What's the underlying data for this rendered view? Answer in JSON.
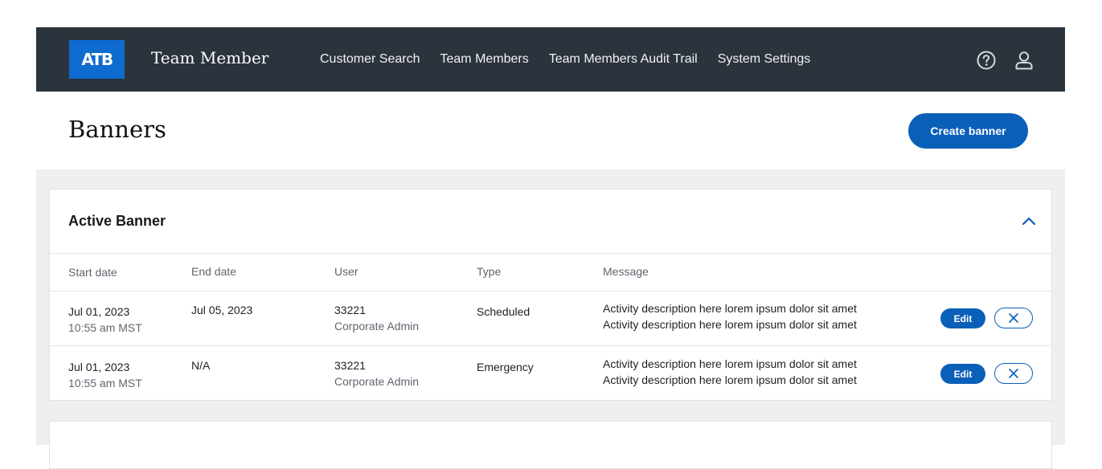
{
  "header": {
    "logo_text": "ATB",
    "app_title": "Team Member",
    "nav": [
      "Customer Search",
      "Team Members",
      "Team Members Audit Trail",
      "System Settings"
    ],
    "icons": [
      "help-circle-icon",
      "user-icon"
    ],
    "background_color": "#2b333c",
    "logo_color": "#0e6bd0"
  },
  "page": {
    "title": "Banners",
    "create_button": "Create banner",
    "accent_color": "#0a5fb8"
  },
  "active_banner": {
    "title": "Active Banner",
    "columns": [
      "Start date",
      "End date",
      "User",
      "Type",
      "Message"
    ],
    "rows": [
      {
        "start_date": "Jul 01, 2023",
        "start_time": "10:55 am MST",
        "end_date": "Jul 05, 2023",
        "user_id": "33221",
        "user_role": "Corporate Admin",
        "type": "Scheduled",
        "message_line1": "Activity description here lorem ipsum dolor sit amet",
        "message_line2": "Activity description here lorem ipsum dolor sit amet",
        "edit_label": "Edit"
      },
      {
        "start_date": "Jul 01, 2023",
        "start_time": "10:55 am MST",
        "end_date": "N/A",
        "user_id": "33221",
        "user_role": "Corporate Admin",
        "type": "Emergency",
        "message_line1": "Activity description here lorem ipsum dolor sit amet",
        "message_line2": "Activity description here lorem ipsum dolor sit amet",
        "edit_label": "Edit"
      }
    ]
  }
}
